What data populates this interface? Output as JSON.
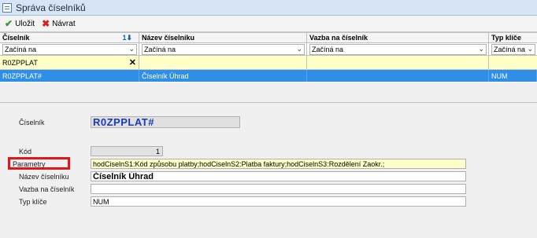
{
  "window": {
    "title": "Správa číselníků"
  },
  "toolbar": {
    "save_label": "Uložit",
    "back_label": "Návrat"
  },
  "grid": {
    "headers": [
      "Číselník",
      "Název číselníku",
      "Vazba na číselník",
      "Typ klíče"
    ],
    "sort_indicator": "1",
    "filters": [
      "Začíná na",
      "Začíná na",
      "Začíná na",
      "Začíná na"
    ],
    "search_value": "R0ZPPLAT",
    "rows": [
      {
        "ciselnik": "R0ZPPLAT#",
        "nazev": "Číselník Úhrad",
        "vazba": "",
        "typ": "NUM"
      }
    ]
  },
  "detail": {
    "ciselnik_label": "Číselník",
    "ciselnik_value": "R0ZPPLAT#",
    "kod_label": "Kód",
    "kod_value": "1",
    "parametry_label": "Parametry",
    "parametry_value": "hodCiselnS1:Kód způsobu platby;hodCiselnS2:Platba faktury;hodCiselnS3:Rozdělení Zaokr.;",
    "nazev_label": "Název číselníku",
    "nazev_value": "Číselník Úhrad",
    "vazba_label": "Vazba na číselník",
    "vazba_value": "",
    "typ_label": "Typ klíče",
    "typ_value": "NUM"
  },
  "colors": {
    "selection": "#2f8fe6",
    "search_row": "#ffffc8",
    "highlight": "#e1151a"
  }
}
